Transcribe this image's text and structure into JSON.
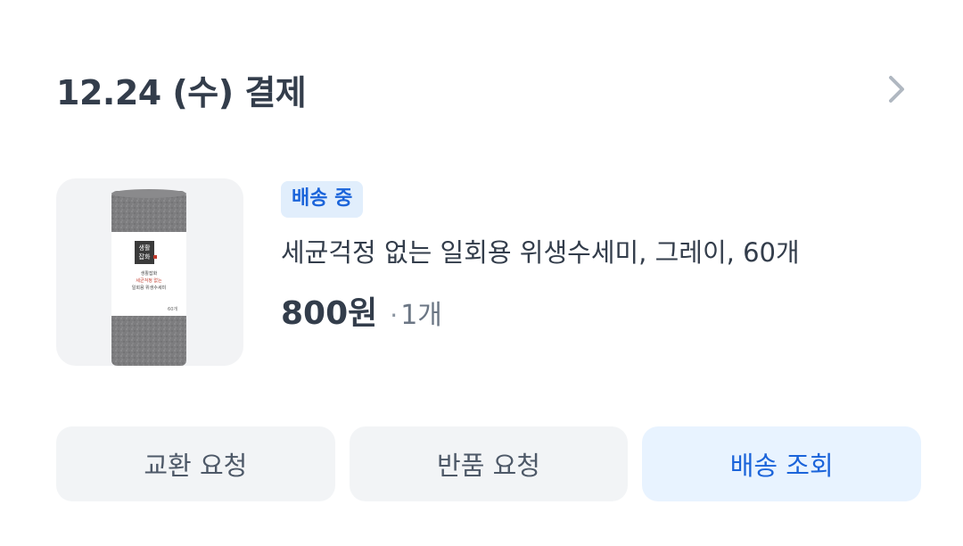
{
  "order": {
    "title": "12.24 (수) 결제"
  },
  "product": {
    "status": "배송 중",
    "name": "세균걱정 없는 일회용 위생수세미, 그레이, 60개",
    "price": "800원",
    "separator": "·",
    "quantity": "1개",
    "image_icon": "product-roll-image",
    "package_text": {
      "brand_line1": "생활",
      "brand_line2": "잡화",
      "line1": "생활잡화",
      "line2": "세균걱정 없는",
      "line3": "일회용 위생수세미",
      "count": "60개"
    }
  },
  "actions": {
    "exchange": "교환 요청",
    "return": "반품 요청",
    "tracking": "배송 조회"
  },
  "colors": {
    "title": "#333d4b",
    "accent": "#1b64da",
    "badge_bg": "#e1eefc",
    "button_bg": "#f2f4f6",
    "primary_button_bg": "#e8f3ff"
  }
}
